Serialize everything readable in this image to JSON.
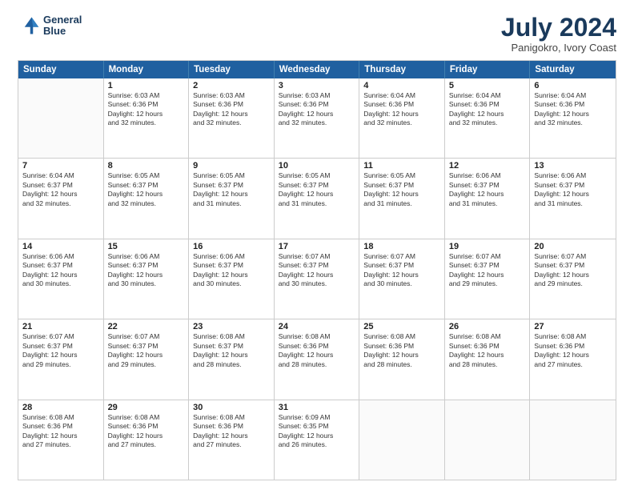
{
  "header": {
    "logo_line1": "General",
    "logo_line2": "Blue",
    "month": "July 2024",
    "location": "Panigokro, Ivory Coast"
  },
  "weekdays": [
    "Sunday",
    "Monday",
    "Tuesday",
    "Wednesday",
    "Thursday",
    "Friday",
    "Saturday"
  ],
  "rows": [
    [
      {
        "day": "",
        "lines": []
      },
      {
        "day": "1",
        "lines": [
          "Sunrise: 6:03 AM",
          "Sunset: 6:36 PM",
          "Daylight: 12 hours",
          "and 32 minutes."
        ]
      },
      {
        "day": "2",
        "lines": [
          "Sunrise: 6:03 AM",
          "Sunset: 6:36 PM",
          "Daylight: 12 hours",
          "and 32 minutes."
        ]
      },
      {
        "day": "3",
        "lines": [
          "Sunrise: 6:03 AM",
          "Sunset: 6:36 PM",
          "Daylight: 12 hours",
          "and 32 minutes."
        ]
      },
      {
        "day": "4",
        "lines": [
          "Sunrise: 6:04 AM",
          "Sunset: 6:36 PM",
          "Daylight: 12 hours",
          "and 32 minutes."
        ]
      },
      {
        "day": "5",
        "lines": [
          "Sunrise: 6:04 AM",
          "Sunset: 6:36 PM",
          "Daylight: 12 hours",
          "and 32 minutes."
        ]
      },
      {
        "day": "6",
        "lines": [
          "Sunrise: 6:04 AM",
          "Sunset: 6:36 PM",
          "Daylight: 12 hours",
          "and 32 minutes."
        ]
      }
    ],
    [
      {
        "day": "7",
        "lines": [
          "Sunrise: 6:04 AM",
          "Sunset: 6:37 PM",
          "Daylight: 12 hours",
          "and 32 minutes."
        ]
      },
      {
        "day": "8",
        "lines": [
          "Sunrise: 6:05 AM",
          "Sunset: 6:37 PM",
          "Daylight: 12 hours",
          "and 32 minutes."
        ]
      },
      {
        "day": "9",
        "lines": [
          "Sunrise: 6:05 AM",
          "Sunset: 6:37 PM",
          "Daylight: 12 hours",
          "and 31 minutes."
        ]
      },
      {
        "day": "10",
        "lines": [
          "Sunrise: 6:05 AM",
          "Sunset: 6:37 PM",
          "Daylight: 12 hours",
          "and 31 minutes."
        ]
      },
      {
        "day": "11",
        "lines": [
          "Sunrise: 6:05 AM",
          "Sunset: 6:37 PM",
          "Daylight: 12 hours",
          "and 31 minutes."
        ]
      },
      {
        "day": "12",
        "lines": [
          "Sunrise: 6:06 AM",
          "Sunset: 6:37 PM",
          "Daylight: 12 hours",
          "and 31 minutes."
        ]
      },
      {
        "day": "13",
        "lines": [
          "Sunrise: 6:06 AM",
          "Sunset: 6:37 PM",
          "Daylight: 12 hours",
          "and 31 minutes."
        ]
      }
    ],
    [
      {
        "day": "14",
        "lines": [
          "Sunrise: 6:06 AM",
          "Sunset: 6:37 PM",
          "Daylight: 12 hours",
          "and 30 minutes."
        ]
      },
      {
        "day": "15",
        "lines": [
          "Sunrise: 6:06 AM",
          "Sunset: 6:37 PM",
          "Daylight: 12 hours",
          "and 30 minutes."
        ]
      },
      {
        "day": "16",
        "lines": [
          "Sunrise: 6:06 AM",
          "Sunset: 6:37 PM",
          "Daylight: 12 hours",
          "and 30 minutes."
        ]
      },
      {
        "day": "17",
        "lines": [
          "Sunrise: 6:07 AM",
          "Sunset: 6:37 PM",
          "Daylight: 12 hours",
          "and 30 minutes."
        ]
      },
      {
        "day": "18",
        "lines": [
          "Sunrise: 6:07 AM",
          "Sunset: 6:37 PM",
          "Daylight: 12 hours",
          "and 30 minutes."
        ]
      },
      {
        "day": "19",
        "lines": [
          "Sunrise: 6:07 AM",
          "Sunset: 6:37 PM",
          "Daylight: 12 hours",
          "and 29 minutes."
        ]
      },
      {
        "day": "20",
        "lines": [
          "Sunrise: 6:07 AM",
          "Sunset: 6:37 PM",
          "Daylight: 12 hours",
          "and 29 minutes."
        ]
      }
    ],
    [
      {
        "day": "21",
        "lines": [
          "Sunrise: 6:07 AM",
          "Sunset: 6:37 PM",
          "Daylight: 12 hours",
          "and 29 minutes."
        ]
      },
      {
        "day": "22",
        "lines": [
          "Sunrise: 6:07 AM",
          "Sunset: 6:37 PM",
          "Daylight: 12 hours",
          "and 29 minutes."
        ]
      },
      {
        "day": "23",
        "lines": [
          "Sunrise: 6:08 AM",
          "Sunset: 6:37 PM",
          "Daylight: 12 hours",
          "and 28 minutes."
        ]
      },
      {
        "day": "24",
        "lines": [
          "Sunrise: 6:08 AM",
          "Sunset: 6:36 PM",
          "Daylight: 12 hours",
          "and 28 minutes."
        ]
      },
      {
        "day": "25",
        "lines": [
          "Sunrise: 6:08 AM",
          "Sunset: 6:36 PM",
          "Daylight: 12 hours",
          "and 28 minutes."
        ]
      },
      {
        "day": "26",
        "lines": [
          "Sunrise: 6:08 AM",
          "Sunset: 6:36 PM",
          "Daylight: 12 hours",
          "and 28 minutes."
        ]
      },
      {
        "day": "27",
        "lines": [
          "Sunrise: 6:08 AM",
          "Sunset: 6:36 PM",
          "Daylight: 12 hours",
          "and 27 minutes."
        ]
      }
    ],
    [
      {
        "day": "28",
        "lines": [
          "Sunrise: 6:08 AM",
          "Sunset: 6:36 PM",
          "Daylight: 12 hours",
          "and 27 minutes."
        ]
      },
      {
        "day": "29",
        "lines": [
          "Sunrise: 6:08 AM",
          "Sunset: 6:36 PM",
          "Daylight: 12 hours",
          "and 27 minutes."
        ]
      },
      {
        "day": "30",
        "lines": [
          "Sunrise: 6:08 AM",
          "Sunset: 6:36 PM",
          "Daylight: 12 hours",
          "and 27 minutes."
        ]
      },
      {
        "day": "31",
        "lines": [
          "Sunrise: 6:09 AM",
          "Sunset: 6:35 PM",
          "Daylight: 12 hours",
          "and 26 minutes."
        ]
      },
      {
        "day": "",
        "lines": []
      },
      {
        "day": "",
        "lines": []
      },
      {
        "day": "",
        "lines": []
      }
    ]
  ]
}
